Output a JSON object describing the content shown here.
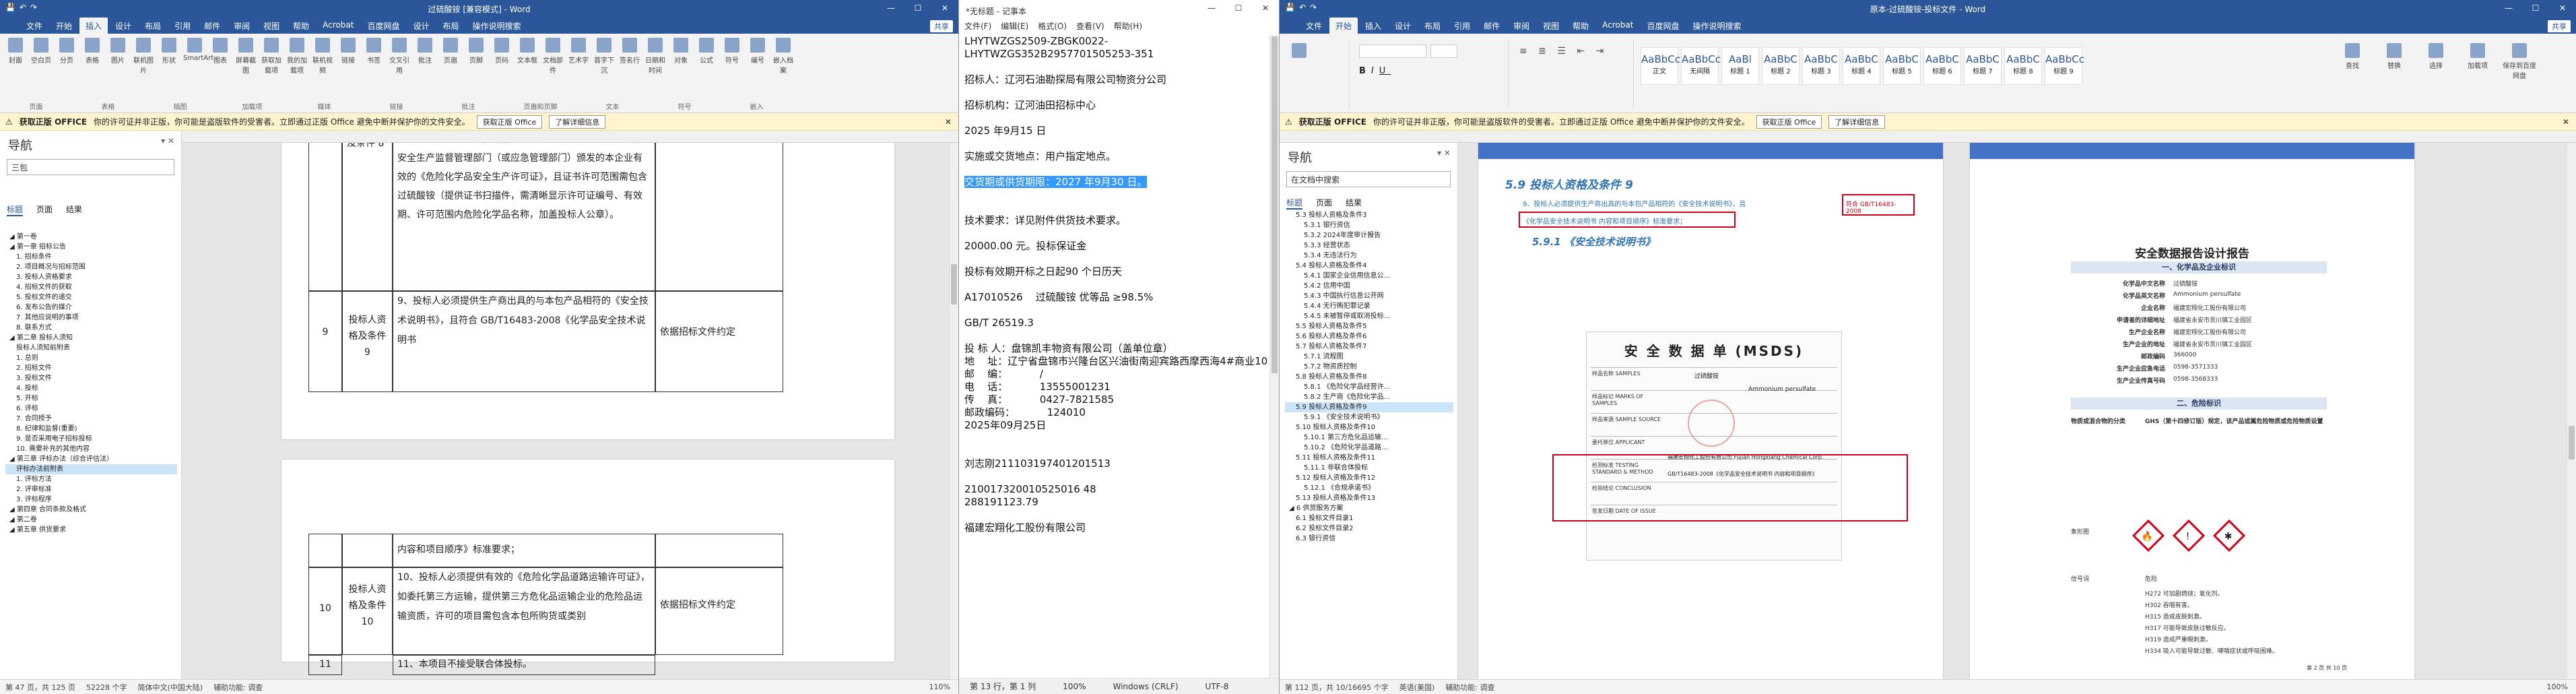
{
  "w1": {
    "title": "过硫酸铵 [兼容模式] - Word",
    "ctx_tab": "表格工具",
    "tabs": [
      "文件",
      "开始",
      "插入",
      "设计",
      "布局",
      "引用",
      "邮件",
      "审阅",
      "视图",
      "帮助",
      "Acrobat",
      "百度网盘",
      "设计",
      "布局",
      "操作说明搜索"
    ],
    "share": "共享",
    "ribbon_groups": [
      "页面",
      "表格",
      "插图",
      "加载项",
      "媒体",
      "链接",
      "批注",
      "页眉和页脚",
      "文本",
      "符号",
      "嵌入"
    ],
    "ribbon_buttons": [
      "封面",
      "空白页",
      "分页",
      "表格",
      "图片",
      "联机图片",
      "形状",
      "SmartArt",
      "图表",
      "屏幕截图",
      "获取加载项",
      "我的加载项",
      "联机视频",
      "链接",
      "书签",
      "交叉引用",
      "批注",
      "页眉",
      "页脚",
      "页码",
      "文本框",
      "文档部件",
      "艺术字",
      "首字下沉",
      "签名行",
      "日期和时间",
      "对象",
      "公式",
      "符号",
      "编号",
      "嵌入档案"
    ],
    "infobar": {
      "badge": "获取正版 OFFICE",
      "text": "你的许可证并非正版，你可能是盗版软件的受害者。立即通过正版 Office 避免中断并保护你的文件安全。",
      "btn1": "获取正版 Office",
      "btn2": "了解详细信息"
    },
    "nav": {
      "title": "导航",
      "search": "三包",
      "tabs": [
        "标题",
        "页面",
        "结果"
      ],
      "items": [
        {
          "t": "第一卷",
          "l": "l1"
        },
        {
          "t": "第一章 招标公告",
          "l": "l1"
        },
        {
          "t": "1. 招标条件",
          "l": "l2"
        },
        {
          "t": "2. 项目概况与招标范围",
          "l": "l2"
        },
        {
          "t": "3. 投标人资格要求",
          "l": "l2"
        },
        {
          "t": "4. 招标文件的获取",
          "l": "l2"
        },
        {
          "t": "5. 投标文件的递交",
          "l": "l2"
        },
        {
          "t": "6. 发布公告的媒介",
          "l": "l2"
        },
        {
          "t": "7. 其他应说明的事项",
          "l": "l2"
        },
        {
          "t": "8. 联系方式",
          "l": "l2"
        },
        {
          "t": "第二章 投标人须知",
          "l": "l1"
        },
        {
          "t": "投标人须知前附表",
          "l": "l2"
        },
        {
          "t": "1. 总则",
          "l": "l2"
        },
        {
          "t": "2. 招标文件",
          "l": "l2"
        },
        {
          "t": "3. 投标文件",
          "l": "l2"
        },
        {
          "t": "4. 投标",
          "l": "l2"
        },
        {
          "t": "5. 开标",
          "l": "l2"
        },
        {
          "t": "6. 评标",
          "l": "l2"
        },
        {
          "t": "7. 合同授予",
          "l": "l2"
        },
        {
          "t": "8. 纪律和监督(重要)",
          "l": "l2"
        },
        {
          "t": "9. 是否采用电子招标投标",
          "l": "l2"
        },
        {
          "t": "10. 需要补充的其他内容",
          "l": "l2"
        },
        {
          "t": "第三章 评标办法（综合评估法）",
          "l": "l1"
        },
        {
          "t": "评标办法前附表",
          "l": "l2",
          "sel": true
        },
        {
          "t": "1. 评标方法",
          "l": "l2"
        },
        {
          "t": "2. 评审标准",
          "l": "l2"
        },
        {
          "t": "3. 评标程序",
          "l": "l2"
        },
        {
          "t": "第四章 合同条款及格式",
          "l": "l1"
        },
        {
          "t": "第二卷",
          "l": "l1"
        },
        {
          "t": "第五章 供货要求",
          "l": "l1"
        }
      ]
    },
    "table": {
      "r0_label": "及条件 8",
      "r0_text": "本企业有效的《危险化学品经营许可证》及生产商有效的由安全生产监督管理部门（或应急管理部门）颁发的本企业有效的《危险化学品安全生产许可证》，且证书许可范围需包含过硫酸铵（提供证书扫描件，需清晰显示许可证编号、有效期、许可范围内危险化学品名称，加盖投标人公章）。",
      "r9_no": "9",
      "r9_label": "投标人资格及条件 9",
      "r9_text": "9、投标人必须提供生产商出具的与本包产品相符的《安全技术说明书》，且符合 GB/T16483-2008《化学品安全技术说明书",
      "r9_crit": "依据招标文件约定",
      "r10_head": "内容和项目顺序》标准要求；",
      "r10_no": "10",
      "r10_label": "投标人资格及条件 10",
      "r10_text": "10、投标人必须提供有效的《危险化学品道路运输许可证》，如委托第三方运输，提供第三方危化品运输企业的危险品运输资质，许可的项目需包含本包所购货或类别",
      "r10_crit": "依据招标文件约定",
      "r11_no": "11",
      "r11_text": "11、本项目不接受联合体投标。"
    },
    "status": [
      "第 47 页，共 125 页",
      "52228 个字",
      "简体中文(中国大陆)",
      "辅助功能: 调查"
    ],
    "zoom": "110%"
  },
  "w2": {
    "title": "*无标题 - 记事本",
    "menu": [
      "文件(F)",
      "编辑(E)",
      "格式(O)",
      "查看(V)",
      "帮助(H)"
    ],
    "lines": [
      "LHYTWZGS2509-ZBGK0022-",
      "LHYTWZGS352B2957701505253-351",
      "",
      "招标人：辽河石油勘探局有限公司物资分公司",
      "",
      "招标机构：辽河油田招标中心",
      "",
      "2025 年9月15 日",
      "",
      "实施或交货地点：用户指定地点。",
      "",
      "",
      "",
      "技术要求：详见附件供货技术要求。",
      "",
      "20000.00 元。投标保证金",
      "",
      "投标有效期开标之日起90 个日历天",
      "",
      "A17010526    过硫酸铵 优等品 ≥98.5%",
      "",
      "GB/T 26519.3",
      "",
      "投 标 人：盘锦凯丰物资有限公司（盖单位章）",
      "地    址：辽宁省盘锦市兴隆台区兴油街南迎宾路西摩西海4#商业101",
      "邮    编：          /",
      "电    话：          13555001231",
      "传    真：          0427-7821585",
      "邮政编码：          124010",
      "2025年09月25日",
      "",
      "",
      "刘志刚211103197401201513",
      "",
      "210017320010525016 48",
      "288191123.79",
      "",
      "福建宏翔化工股份有限公司"
    ],
    "selected_line": "交货期或供货期限：2027 年9月30 日。",
    "status": [
      "第 13 行，第 1 列",
      "100%",
      "Windows (CRLF)",
      "UTF-8"
    ]
  },
  "w3": {
    "title": "原本-过硫酸铵-投标文件 - Word",
    "tabs": [
      "文件",
      "开始",
      "插入",
      "设计",
      "布局",
      "引用",
      "邮件",
      "审阅",
      "视图",
      "帮助",
      "Acrobat",
      "百度网盘",
      "操作说明搜索"
    ],
    "share": "共享",
    "styles": [
      {
        "s": "AaBbCcDd",
        "n": "正文"
      },
      {
        "s": "AaBbCcDı",
        "n": "无间隔"
      },
      {
        "s": "AaBl",
        "n": "标题 1"
      },
      {
        "s": "AaBbC",
        "n": "标题 2"
      },
      {
        "s": "AaBbC",
        "n": "标题 3"
      },
      {
        "s": "AaBbC",
        "n": "标题 4"
      },
      {
        "s": "AaBbC",
        "n": "标题 5"
      },
      {
        "s": "AaBbC",
        "n": "标题 6"
      },
      {
        "s": "AaBbC",
        "n": "标题 7"
      },
      {
        "s": "AaBbC",
        "n": "标题 8"
      },
      {
        "s": "AaBbCc",
        "n": "标题 9"
      }
    ],
    "right_groups": [
      "查找",
      "替换",
      "选择",
      "加载项",
      "保存到百度网盘"
    ],
    "infobar": {
      "badge": "获取正版 OFFICE",
      "text": "你的许可证并非正版，你可能是盗版软件的受害者。立即通过正版 Office 避免中断并保护你的文件安全。",
      "btn1": "获取正版 Office",
      "btn2": "了解详细信息"
    },
    "nav": {
      "title": "导航",
      "search": "在文档中搜索",
      "tabs": [
        "标题",
        "页面",
        "结果"
      ],
      "items": [
        {
          "t": "5.3 投标人资格及条件3",
          "l": "l2"
        },
        {
          "t": "5.3.1 银行资信",
          "l": "l3"
        },
        {
          "t": "5.3.2 2024年度审计报告",
          "l": "l3"
        },
        {
          "t": "5.3.3 经营状态",
          "l": "l3"
        },
        {
          "t": "5.3.4 无违法行为",
          "l": "l3"
        },
        {
          "t": "5.4 投标人资格及条件4",
          "l": "l2"
        },
        {
          "t": "5.4.1 国家企业信用信息公...",
          "l": "l3"
        },
        {
          "t": "5.4.2 信用中国",
          "l": "l3"
        },
        {
          "t": "5.4.3 中国执行信息公开网",
          "l": "l3"
        },
        {
          "t": "5.4.4 无行贿犯罪记录",
          "l": "l3"
        },
        {
          "t": "5.4.5 未被暂停或取消投标...",
          "l": "l3"
        },
        {
          "t": "5.5 投标人资格及条件5",
          "l": "l2"
        },
        {
          "t": "5.6 投标人资格及条件6",
          "l": "l2"
        },
        {
          "t": "5.7 投标人资格及条件7",
          "l": "l2"
        },
        {
          "t": "5.7.1 流程图",
          "l": "l3"
        },
        {
          "t": "5.7.2 物资质控制",
          "l": "l3"
        },
        {
          "t": "5.8 投标人资格及条件8",
          "l": "l2"
        },
        {
          "t": "5.8.1 《危险化学品经营许...",
          "l": "l3"
        },
        {
          "t": "5.8.2 生产商《危险化学品...",
          "l": "l3"
        },
        {
          "t": "5.9 投标人资格及条件9",
          "l": "l2",
          "sel": true
        },
        {
          "t": "5.9.1 《安全技术说明书》",
          "l": "l3"
        },
        {
          "t": "5.10 投标人资格及条件10",
          "l": "l2"
        },
        {
          "t": "5.10.1 第三方危化品运输...",
          "l": "l3"
        },
        {
          "t": "5.10.2 《危险化学品道路...",
          "l": "l3"
        },
        {
          "t": "5.11 投标人资格及条件11",
          "l": "l2"
        },
        {
          "t": "5.11.1 非联合体投标",
          "l": "l3"
        },
        {
          "t": "5.12 投标人资格及条件12",
          "l": "l2"
        },
        {
          "t": "5.12.1 《合规承诺书》",
          "l": "l3"
        },
        {
          "t": "5.13 投标人资格及条件13",
          "l": "l2"
        },
        {
          "t": "6 供货服务方案",
          "l": "l1"
        },
        {
          "t": "6.1 投标文件目录1",
          "l": "l2"
        },
        {
          "t": "6.2 投标文件目录2",
          "l": "l2"
        },
        {
          "t": "6.3 银行资信",
          "l": "l2"
        }
      ]
    },
    "doc": {
      "heading": "5.9 投标人资格及条件 9",
      "req_text": "9、投标人必须提供生产商出具的与本包产品相符的《安全技术说明书》，且",
      "req_red": "符合 GB/T16483-2008",
      "req_text2": "《化学品安全技术说明书 内容和项目顺序》标准要求；",
      "sub": "5.9.1 《安全技术说明书》",
      "msds_title": "安 全 数 据 单 (MSDS)",
      "msds_rows": [
        "样品名称 SAMPLES",
        "样品标记 MARKS OF SAMPLES",
        "样品来源 SAMPLE SOURCE",
        "委托单位 APPLICANT",
        "检测标准 TESTING STANDARD & METHOD",
        "检验结论 CONCLUSION",
        "签发日期 DATE OF ISSUE"
      ],
      "msds_cn": "过硫酸铵",
      "msds_en": "Ammonium persulfate",
      "msds_applicant": "福建宏翔化工股份有限公司 Fujian Hongxiang Chemical Corp.",
      "msds_std": "GB/T16483-2008《化学品安全技术说明书 内容和项目顺序》",
      "report_title": "安全数据报告设计报告",
      "sec1": "一、化学品及企业标识",
      "sec1_items": [
        {
          "k": "化学品中文名称",
          "v": "过硫酸铵"
        },
        {
          "k": "化学品英文名称",
          "v": "Ammonium persulfate"
        },
        {
          "k": "企业名称",
          "v": "福建宏翔化工股份有限公司"
        },
        {
          "k": "申请者的详细地址",
          "v": "福建省永安市贡川镇工业园区"
        },
        {
          "k": "生产企业名称",
          "v": "福建宏翔化工股份有限公司"
        },
        {
          "k": "生产企业的地址",
          "v": "福建省永安市贡川镇工业园区"
        },
        {
          "k": "邮政编码",
          "v": "366000"
        },
        {
          "k": "生产企业应急电话",
          "v": "0598-3571333"
        },
        {
          "k": "生产企业传真号码",
          "v": "0598-3568333"
        }
      ],
      "sec2": "二、危险标识",
      "sec2_label": "物质或混合物的分类",
      "sec2_text": "GHS（第十四修订版）规定，该产品或属危险物质或危险物质设置",
      "pictogram_label": "象形图",
      "signal_label": "信号词",
      "signal_word": "危险",
      "h_lines": [
        "H272 可加剧燃烧；氧化剂。",
        "H302 吞咽有害。",
        "H315 造成皮肤刺激。",
        "H317 可能导致皮肤过敏反应。",
        "H319 造成严重眼刺激。",
        "H334 吸入可能导致过敏、哮喘症状或呼吸困难。"
      ],
      "footer": "第 2 页 共 10 页"
    },
    "status": [
      "第 112 页，共 10/16695 个字",
      "英语(美国)",
      "辅助功能: 调查"
    ],
    "zoom": "100%"
  },
  "colors": {
    "word_blue": "#2b579a",
    "info_yellow": "#fff4ce",
    "red_box": "#d0021b",
    "heading_blue": "#2e74b5",
    "selection": "#3399ff"
  }
}
